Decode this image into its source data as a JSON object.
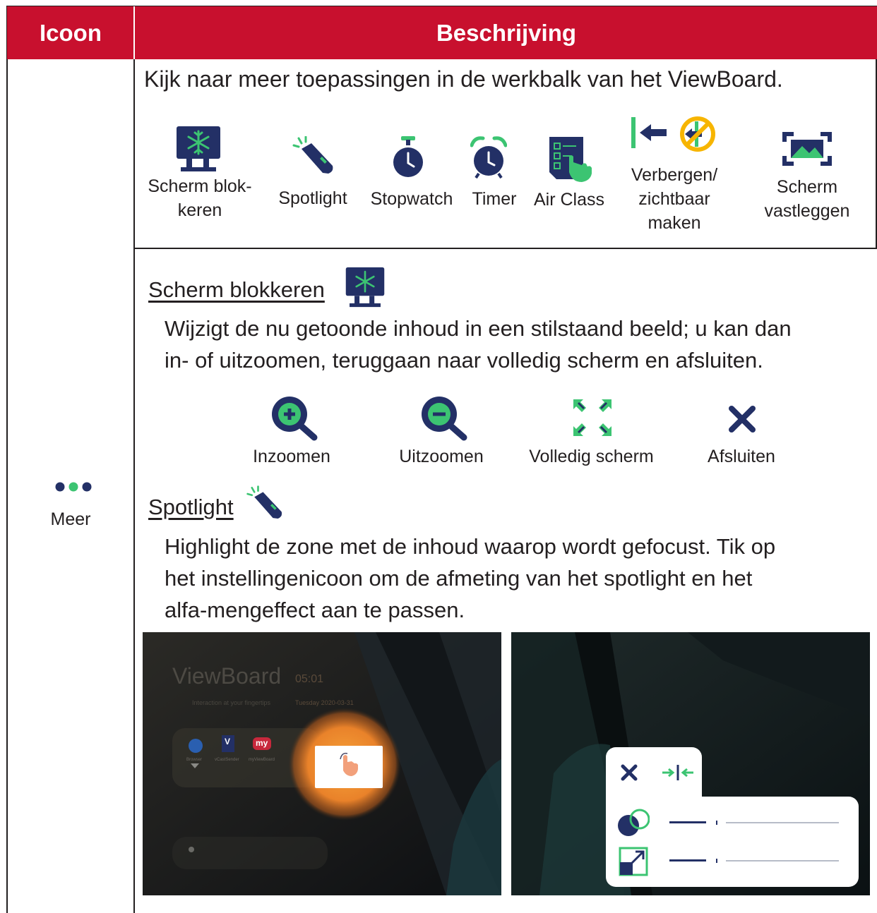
{
  "colors": {
    "header_red": "#c8102e",
    "icon_navy": "#233066",
    "icon_green": "#3cc472",
    "spot_orange": "#f59b2e"
  },
  "table": {
    "header": {
      "col_icon": "Icoon",
      "col_desc": "Beschrijving"
    },
    "row": {
      "icon_name": "more-dots-icon",
      "icon_label": "Meer",
      "intro": "Kijk naar meer toepassingen in de werkbalk van het ViewBoard.",
      "toolbar_items": [
        {
          "icon": "freeze-screen-icon",
          "label": "Scherm blok-\nkeren"
        },
        {
          "icon": "spotlight-icon",
          "label": "Spotlight"
        },
        {
          "icon": "stopwatch-icon",
          "label": "Stopwatch"
        },
        {
          "icon": "timer-icon",
          "label": "Timer"
        },
        {
          "icon": "air-class-icon",
          "label": "Air Class"
        },
        {
          "icon": "hide-show-toolbar-icon",
          "label": "Verbergen/\nzichtbaar\nmaken"
        },
        {
          "icon": "screen-capture-icon",
          "label": "Scherm\nvastleggen"
        }
      ]
    },
    "freeze": {
      "title": "Scherm blokkeren",
      "description_line1": "Wijzigt de nu getoonde inhoud in een stilstaand beeld; u kan dan",
      "description_line2": "in- of uitzoomen, teruggaan naar volledig scherm en afsluiten.",
      "controls": [
        {
          "icon": "zoom-in-icon",
          "label": "Inzoomen"
        },
        {
          "icon": "zoom-out-icon",
          "label": "Uitzoomen"
        },
        {
          "icon": "fullscreen-icon",
          "label": "Volledig scherm"
        },
        {
          "icon": "close-icon",
          "label": "Afsluiten"
        }
      ]
    },
    "spotlight": {
      "title": "Spotlight",
      "description_line1": "Highlight de zone met de inhoud waarop wordt gefocust. Tik op",
      "description_line2": "het instellingenicoon om de afmeting van het spotlight en het",
      "description_line3": "alfa-mengeffect aan te passen.",
      "screenshot1": {
        "brand": "ViewBoard",
        "time": "05:01",
        "tagline": "Interaction at your fingertips",
        "date": "Tuesday 2020-03-31",
        "apps": [
          "Browser",
          "vCastSender",
          "myViewBoard"
        ],
        "app_badges": [
          "V",
          "my"
        ]
      },
      "screenshot2": {
        "opacity_level": 0.35,
        "size_level": 0.35
      }
    }
  }
}
